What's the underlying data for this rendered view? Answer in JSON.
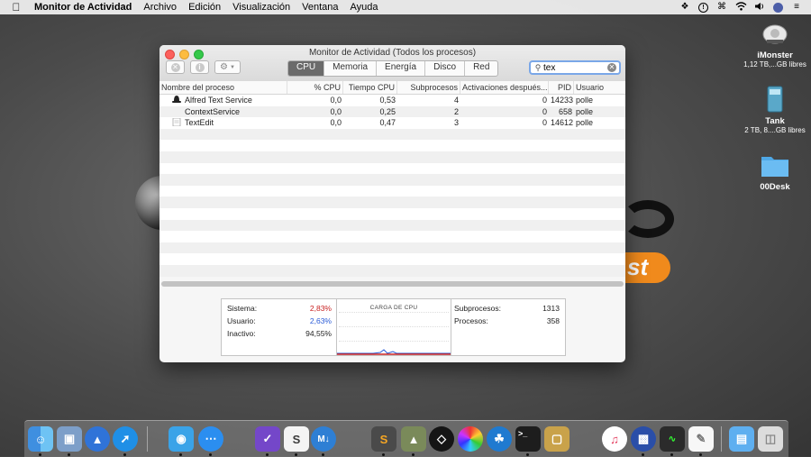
{
  "menubar": {
    "app": "Monitor de Actividad",
    "items": [
      "Archivo",
      "Edición",
      "Visualización",
      "Ventana",
      "Ayuda"
    ]
  },
  "desktop": {
    "icons": [
      {
        "name": "iMonster",
        "sub": "1,12 TB,...GB libres"
      },
      {
        "name": "Tank",
        "sub": "2 TB, 8....GB libres"
      },
      {
        "name": "00Desk",
        "sub": ""
      }
    ],
    "wallpaper_text": "st"
  },
  "window": {
    "title": "Monitor de Actividad (Todos los procesos)",
    "tabs": [
      "CPU",
      "Memoria",
      "Energía",
      "Disco",
      "Red"
    ],
    "active_tab": "CPU",
    "search": {
      "value": "tex"
    },
    "columns": [
      "Nombre del proceso",
      "% CPU",
      "Tiempo CPU",
      "Subprocesos",
      "Activaciones después...",
      "PID",
      "Usuario"
    ],
    "rows": [
      {
        "name": "Alfred Text Service",
        "cpu": "0,0",
        "time": "0,53",
        "threads": "4",
        "wakeups": "0",
        "pid": "14233",
        "user": "polle",
        "icon": "alfred-hat-icon"
      },
      {
        "name": "ContextService",
        "cpu": "0,0",
        "time": "0,25",
        "threads": "2",
        "wakeups": "0",
        "pid": "658",
        "user": "polle",
        "icon": ""
      },
      {
        "name": "TextEdit",
        "cpu": "0,0",
        "time": "0,47",
        "threads": "3",
        "wakeups": "0",
        "pid": "14612",
        "user": "polle",
        "icon": "textedit-icon"
      }
    ],
    "summary": {
      "sistema_label": "Sistema:",
      "sistema": "2,83%",
      "usuario_label": "Usuario:",
      "usuario": "2,63%",
      "inactivo_label": "Inactivo:",
      "inactivo": "94,55%",
      "graph_title": "CARGA DE CPU",
      "subprocesos_label": "Subprocesos:",
      "subprocesos": "1313",
      "procesos_label": "Procesos:",
      "procesos": "358"
    }
  },
  "colors": {
    "system": "#c82121",
    "user": "#2a5bd7",
    "accent": "#6b6b6b"
  },
  "dock": {
    "apps": [
      "finder-icon",
      "preview-icon",
      "launchpad-icon",
      "safari-icon",
      "tweetbot-icon",
      "messenger-icon",
      "omnifocus-icon",
      "slack-icon",
      "markdown-icon",
      "sublime-icon",
      "transmit-icon",
      "sourcetree-icon",
      "color-icon",
      "mamp-icon",
      "terminal-icon",
      "archive-icon",
      "music-icon",
      "screen-icon",
      "activity-monitor-icon",
      "textedit-icon",
      "folder-icon",
      "trash-icon"
    ]
  }
}
